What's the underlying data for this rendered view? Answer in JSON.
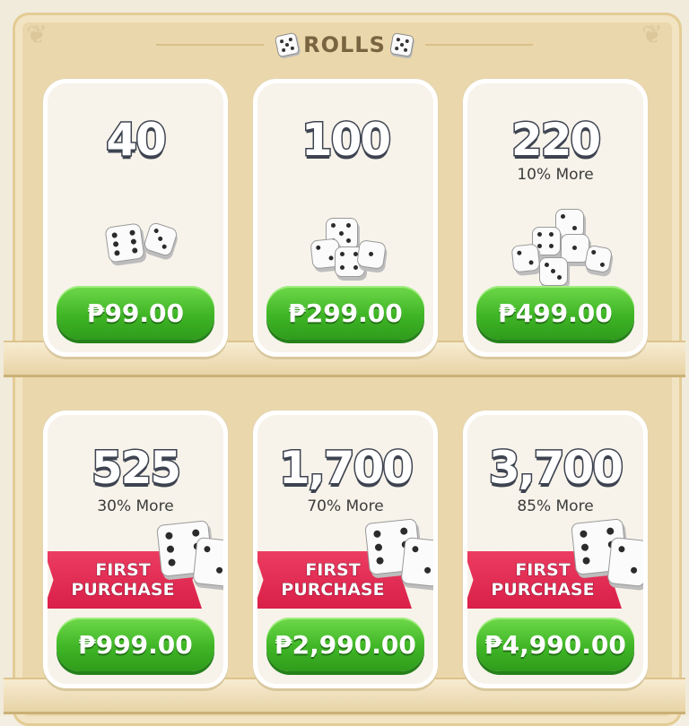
{
  "header": {
    "title": "ROLLS",
    "icon_left": "dice-icon",
    "icon_right": "dice-icon"
  },
  "packs": [
    {
      "amount": "40",
      "bonus": "",
      "price": "₱99.00",
      "badge": ""
    },
    {
      "amount": "100",
      "bonus": "",
      "price": "₱299.00",
      "badge": ""
    },
    {
      "amount": "220",
      "bonus": "10% More",
      "price": "₱499.00",
      "badge": ""
    },
    {
      "amount": "525",
      "bonus": "30% More",
      "price": "₱999.00",
      "badge_line1": "FIRST",
      "badge_line2": "PURCHASE"
    },
    {
      "amount": "1,700",
      "bonus": "70% More",
      "price": "₱2,990.00",
      "badge_line1": "FIRST",
      "badge_line2": "PURCHASE"
    },
    {
      "amount": "3,700",
      "bonus": "85% More",
      "price": "₱4,990.00",
      "badge_line1": "FIRST",
      "badge_line2": "PURCHASE"
    }
  ],
  "colors": {
    "button_green": "#3fb526",
    "ribbon_red": "#d91f48",
    "frame_tan": "#ead7ab"
  }
}
